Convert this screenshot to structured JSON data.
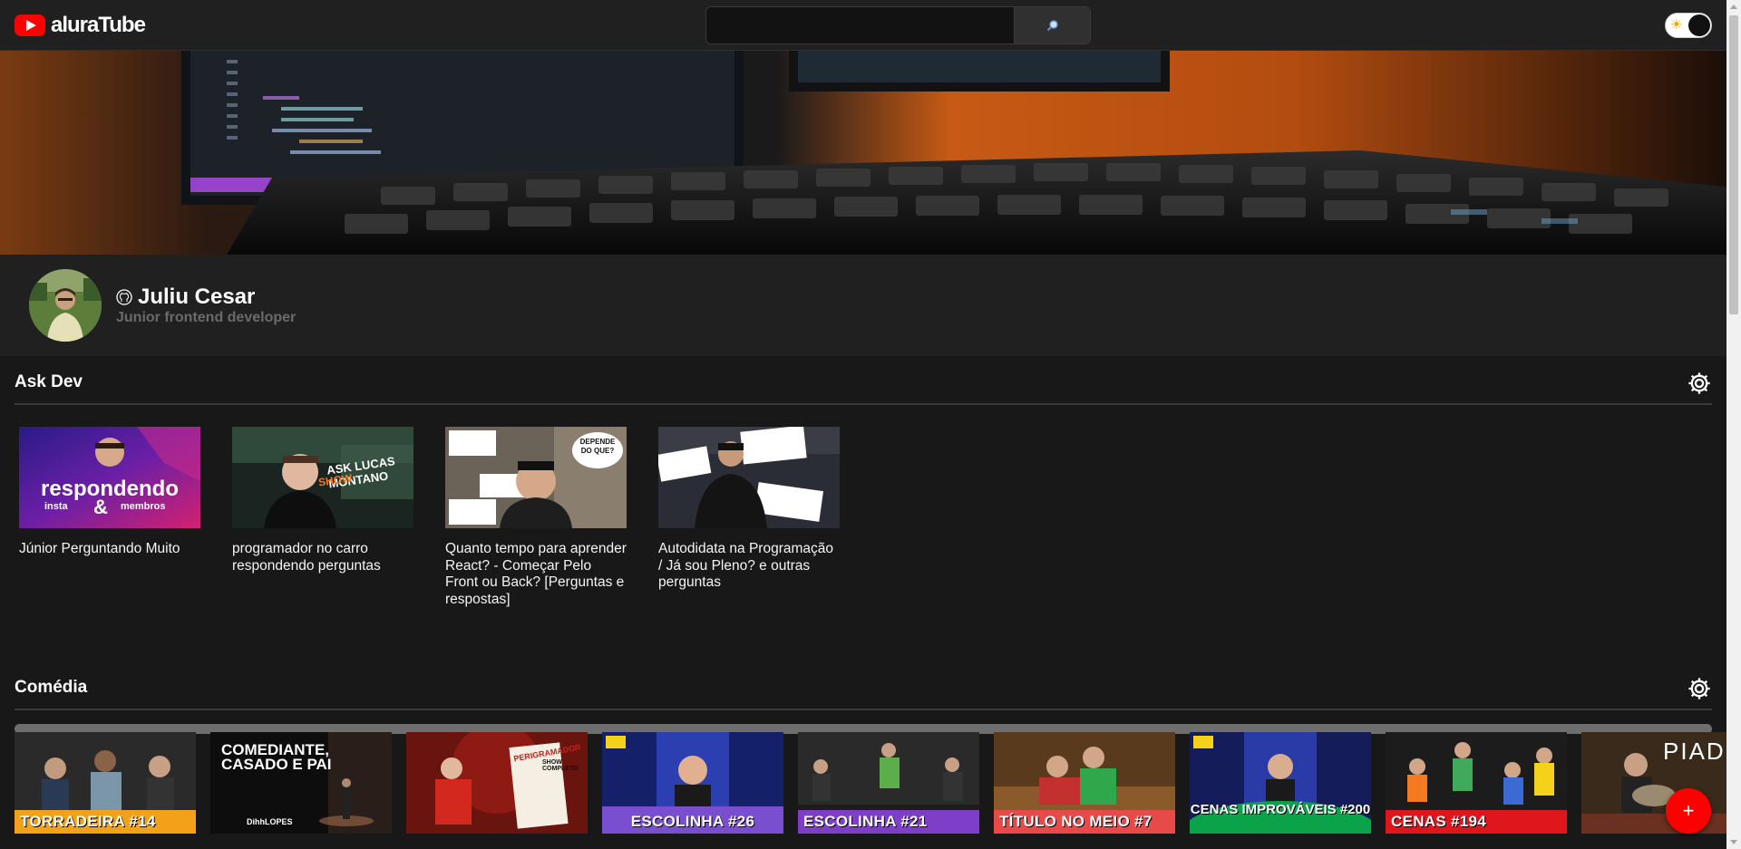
{
  "header": {
    "logo_text": "aluraTube",
    "search_placeholder": "",
    "search_icon": "magnifier-icon",
    "theme_icon": "sun-icon",
    "brand_color": "#ff0000"
  },
  "profile": {
    "name": "Juliu Cesar",
    "role": "Junior frontend developer",
    "github_icon": "github-icon"
  },
  "sections": [
    {
      "title": "Ask Dev",
      "videos": [
        {
          "title": "Júnior Perguntando Muito",
          "thumb_text": "respondendo",
          "thumb_sub_left": "insta",
          "thumb_amp": "&",
          "thumb_sub_right": "membros"
        },
        {
          "title": "programador no carro respondendo perguntas",
          "thumb_text": "ASK LUCAS MONTANO",
          "thumb_badge": "SHOW"
        },
        {
          "title": "Quanto tempo para aprender React? - Começar Pelo Front ou Back? [Perguntas e respostas]",
          "thumb_bubble": "DEPENDE DO QUE?"
        },
        {
          "title": "Autodidata na Programação / Já sou Pleno? e outras perguntas"
        }
      ]
    },
    {
      "title": "Comédia",
      "videos": [
        {
          "label": "TORRADEIRA #14",
          "label_color": "#f4a11a"
        },
        {
          "label": "COMEDIANTE, CASADO E PAI",
          "label_color": "#000000",
          "accent": "#f47a1f",
          "thumb_footer": "DihhLOPES"
        },
        {
          "label": "PERIGRAMADOR",
          "label_color": "#c0211f",
          "badge": "SHOW COMPLETO"
        },
        {
          "label": "ESCOLINHA #26",
          "label_color": "#7e3ec8"
        },
        {
          "label": "ESCOLINHA #21",
          "label_color": "#7e3ec8"
        },
        {
          "label": "TÍTULO NO MEIO #7",
          "label_color": "#e84a4a"
        },
        {
          "label": "CENAS IMPROVÁVEIS #200",
          "label_color": "#0aa34a"
        },
        {
          "label": "CENAS #194",
          "label_color": "#e0161d"
        },
        {
          "label": "PIAD",
          "label_color": "#000000"
        }
      ]
    }
  ],
  "fab_label": "+"
}
